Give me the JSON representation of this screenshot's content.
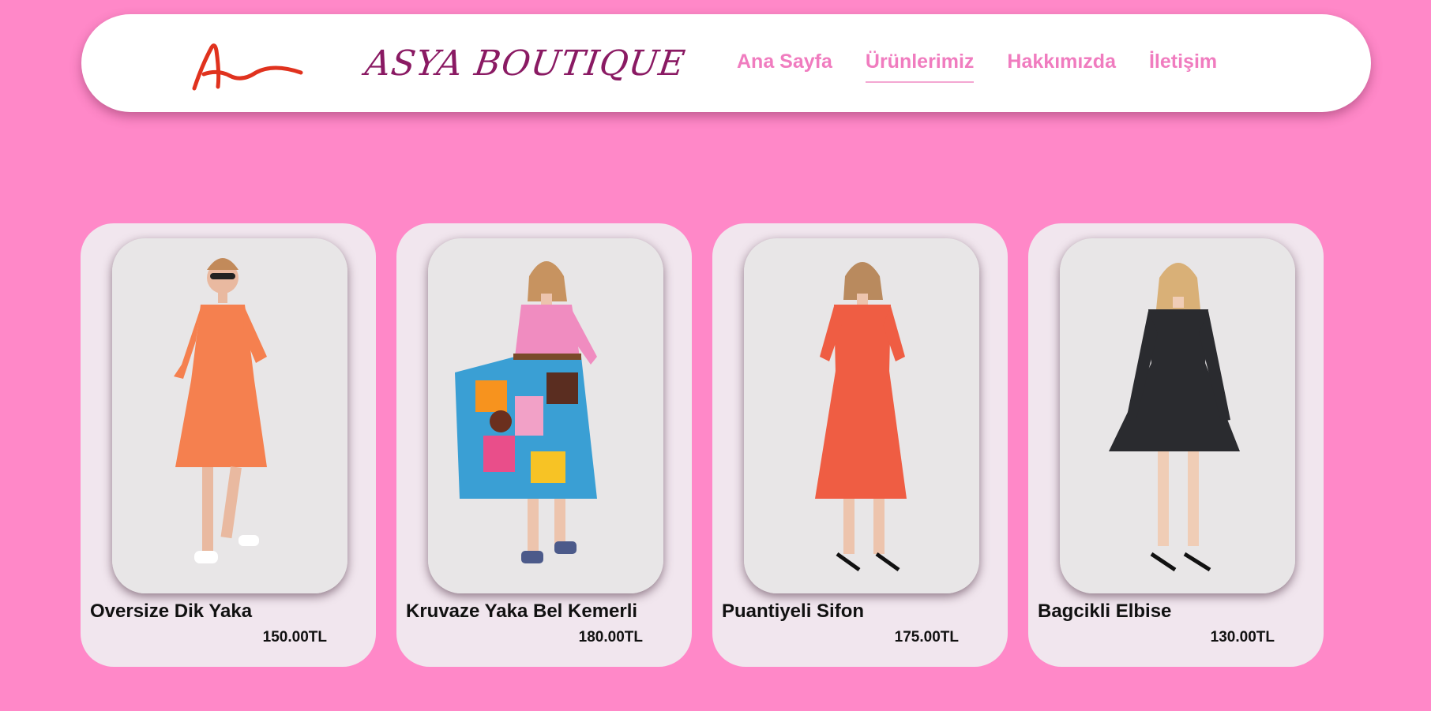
{
  "header": {
    "brand": "ASYA BOUTIQUE",
    "logo_icon": "asya-logo-icon",
    "nav": [
      {
        "label": "Ana Sayfa",
        "active": false
      },
      {
        "label": "Ürünlerimiz",
        "active": true
      },
      {
        "label": "Hakkımızda",
        "active": false
      },
      {
        "label": "İletişim",
        "active": false
      }
    ]
  },
  "colors": {
    "background": "#ff88c8",
    "brand_text": "#8a1a63",
    "nav_text": "#f07cbf",
    "card_bg": "#f1e6ee",
    "logo": "#e0321e"
  },
  "products": [
    {
      "name": "Oversize Dik Yaka",
      "price": "150.00TL",
      "dress_color": "#f5804f"
    },
    {
      "name": "Kruvaze Yaka Bel Kemerli",
      "price": "180.00TL",
      "dress_color": "#f08cc0"
    },
    {
      "name": "Puantiyeli Sifon",
      "price": "175.00TL",
      "dress_color": "#ef5d43"
    },
    {
      "name": "Bagcikli Elbise",
      "price": "130.00TL",
      "dress_color": "#2a2b2f"
    }
  ]
}
